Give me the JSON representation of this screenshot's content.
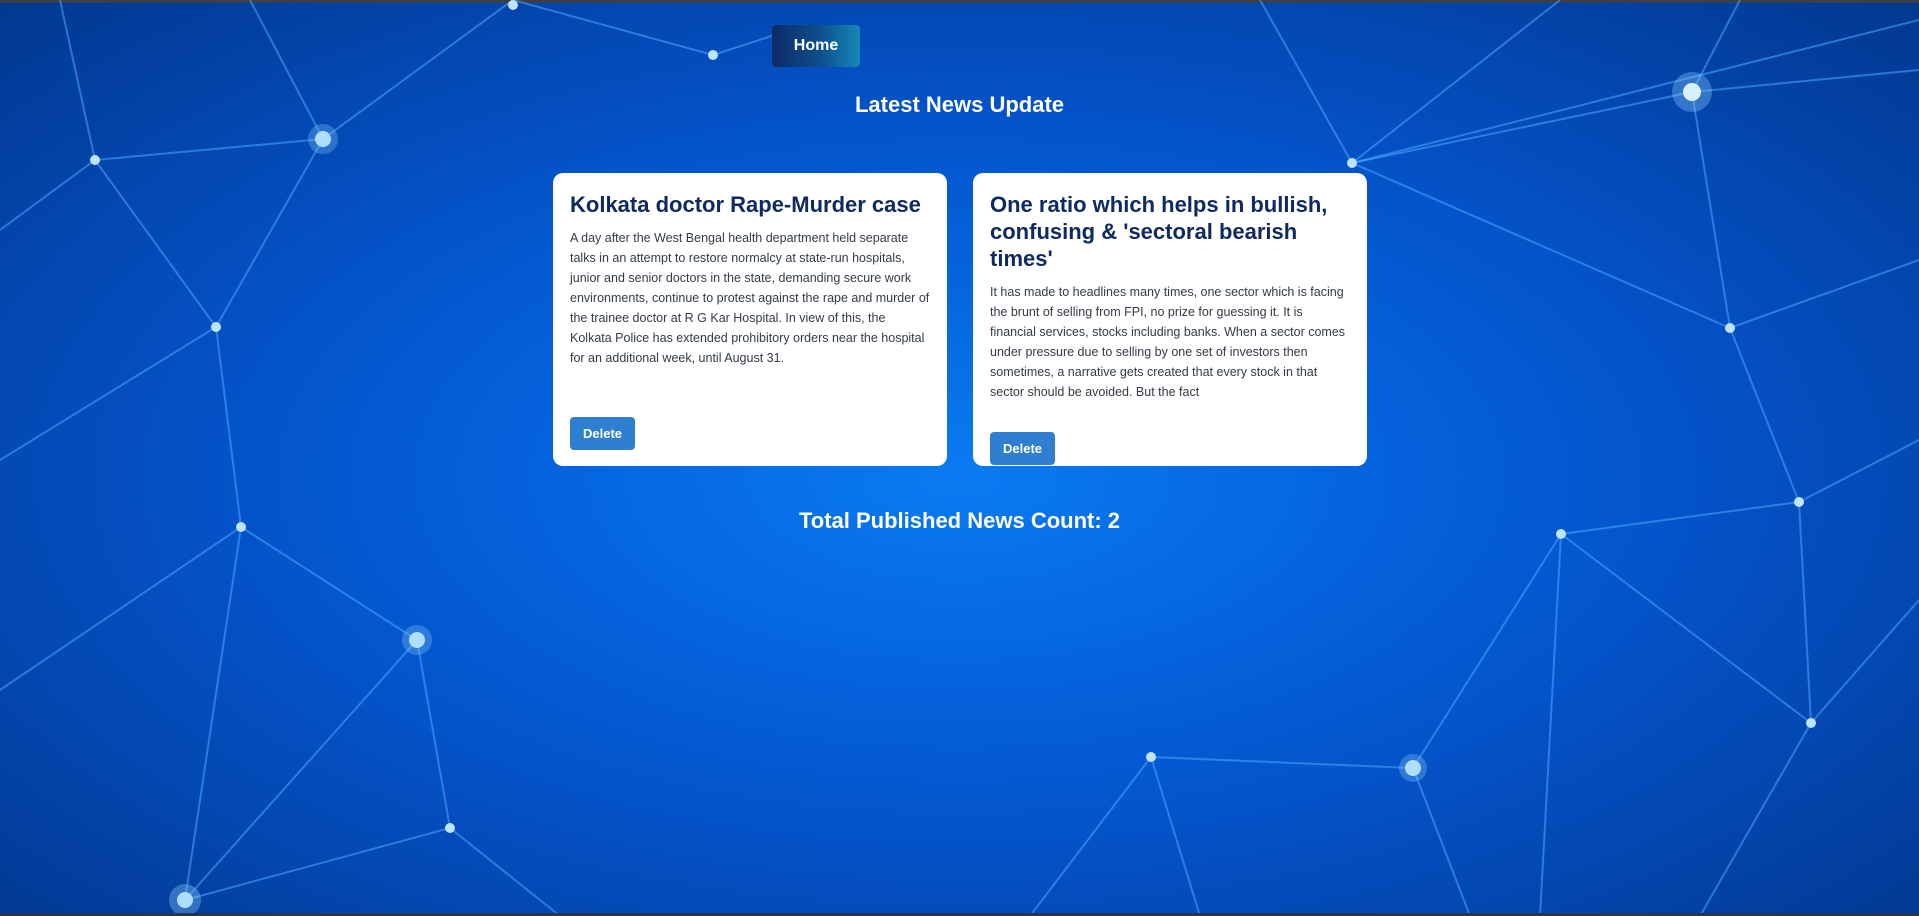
{
  "nav": {
    "home_label": "Home"
  },
  "page": {
    "title": "Latest News Update"
  },
  "news": [
    {
      "title": "Kolkata doctor Rape-Murder case",
      "body": "A day after the West Bengal health department held separate talks in an attempt to restore normalcy at state-run hospitals, junior and senior doctors in the state, demanding secure work environments, continue to protest against the rape and murder of the trainee doctor at R G Kar Hospital. In view of this, the Kolkata Police has extended prohibitory orders near the hospital for an additional week, until August 31.",
      "delete_label": "Delete"
    },
    {
      "title": "One ratio which helps in bullish, confusing & 'sectoral bearish times'",
      "body": "It has made to headlines many times, one sector which is facing the brunt of selling from FPI, no prize for guessing it. It is financial services, stocks including banks. When a sector comes under pressure due to selling by one set of investors then sometimes, a narrative gets created that every stock in that sector should be avoided. But the fact",
      "delete_label": "Delete"
    }
  ],
  "footer": {
    "count_text": "Total Published News Count: 2"
  },
  "colors": {
    "background": "#0565e0",
    "card_title": "#0f2a63",
    "delete_button": "#2f7fd0",
    "home_button_start": "#0d2a67",
    "home_button_end": "#1489b6"
  }
}
